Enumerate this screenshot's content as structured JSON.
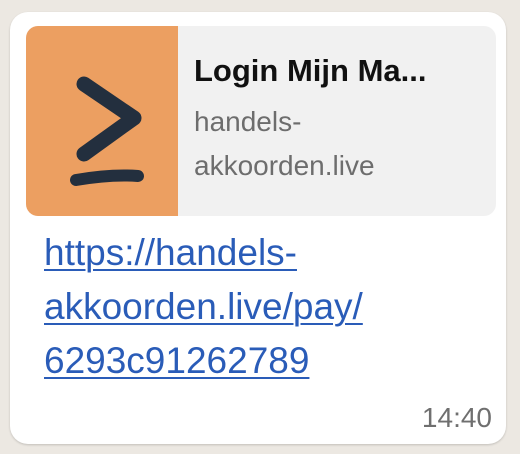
{
  "preview": {
    "title": "Login Mijn Ma...",
    "domain_line1": "handels-",
    "domain_line2": "akkoorden.live",
    "thumbnail_icon": "greater-than-or-equal-icon",
    "thumbnail_color": "#ec9f61"
  },
  "message": {
    "link_line1": "https://handels-",
    "link_line2": "akkoorden.live/pay/",
    "link_line3": "6293c91262789",
    "time": "14:40"
  },
  "colors": {
    "link": "#2a5cb8",
    "bubble": "#ffffff",
    "icon": "#232f3e"
  }
}
